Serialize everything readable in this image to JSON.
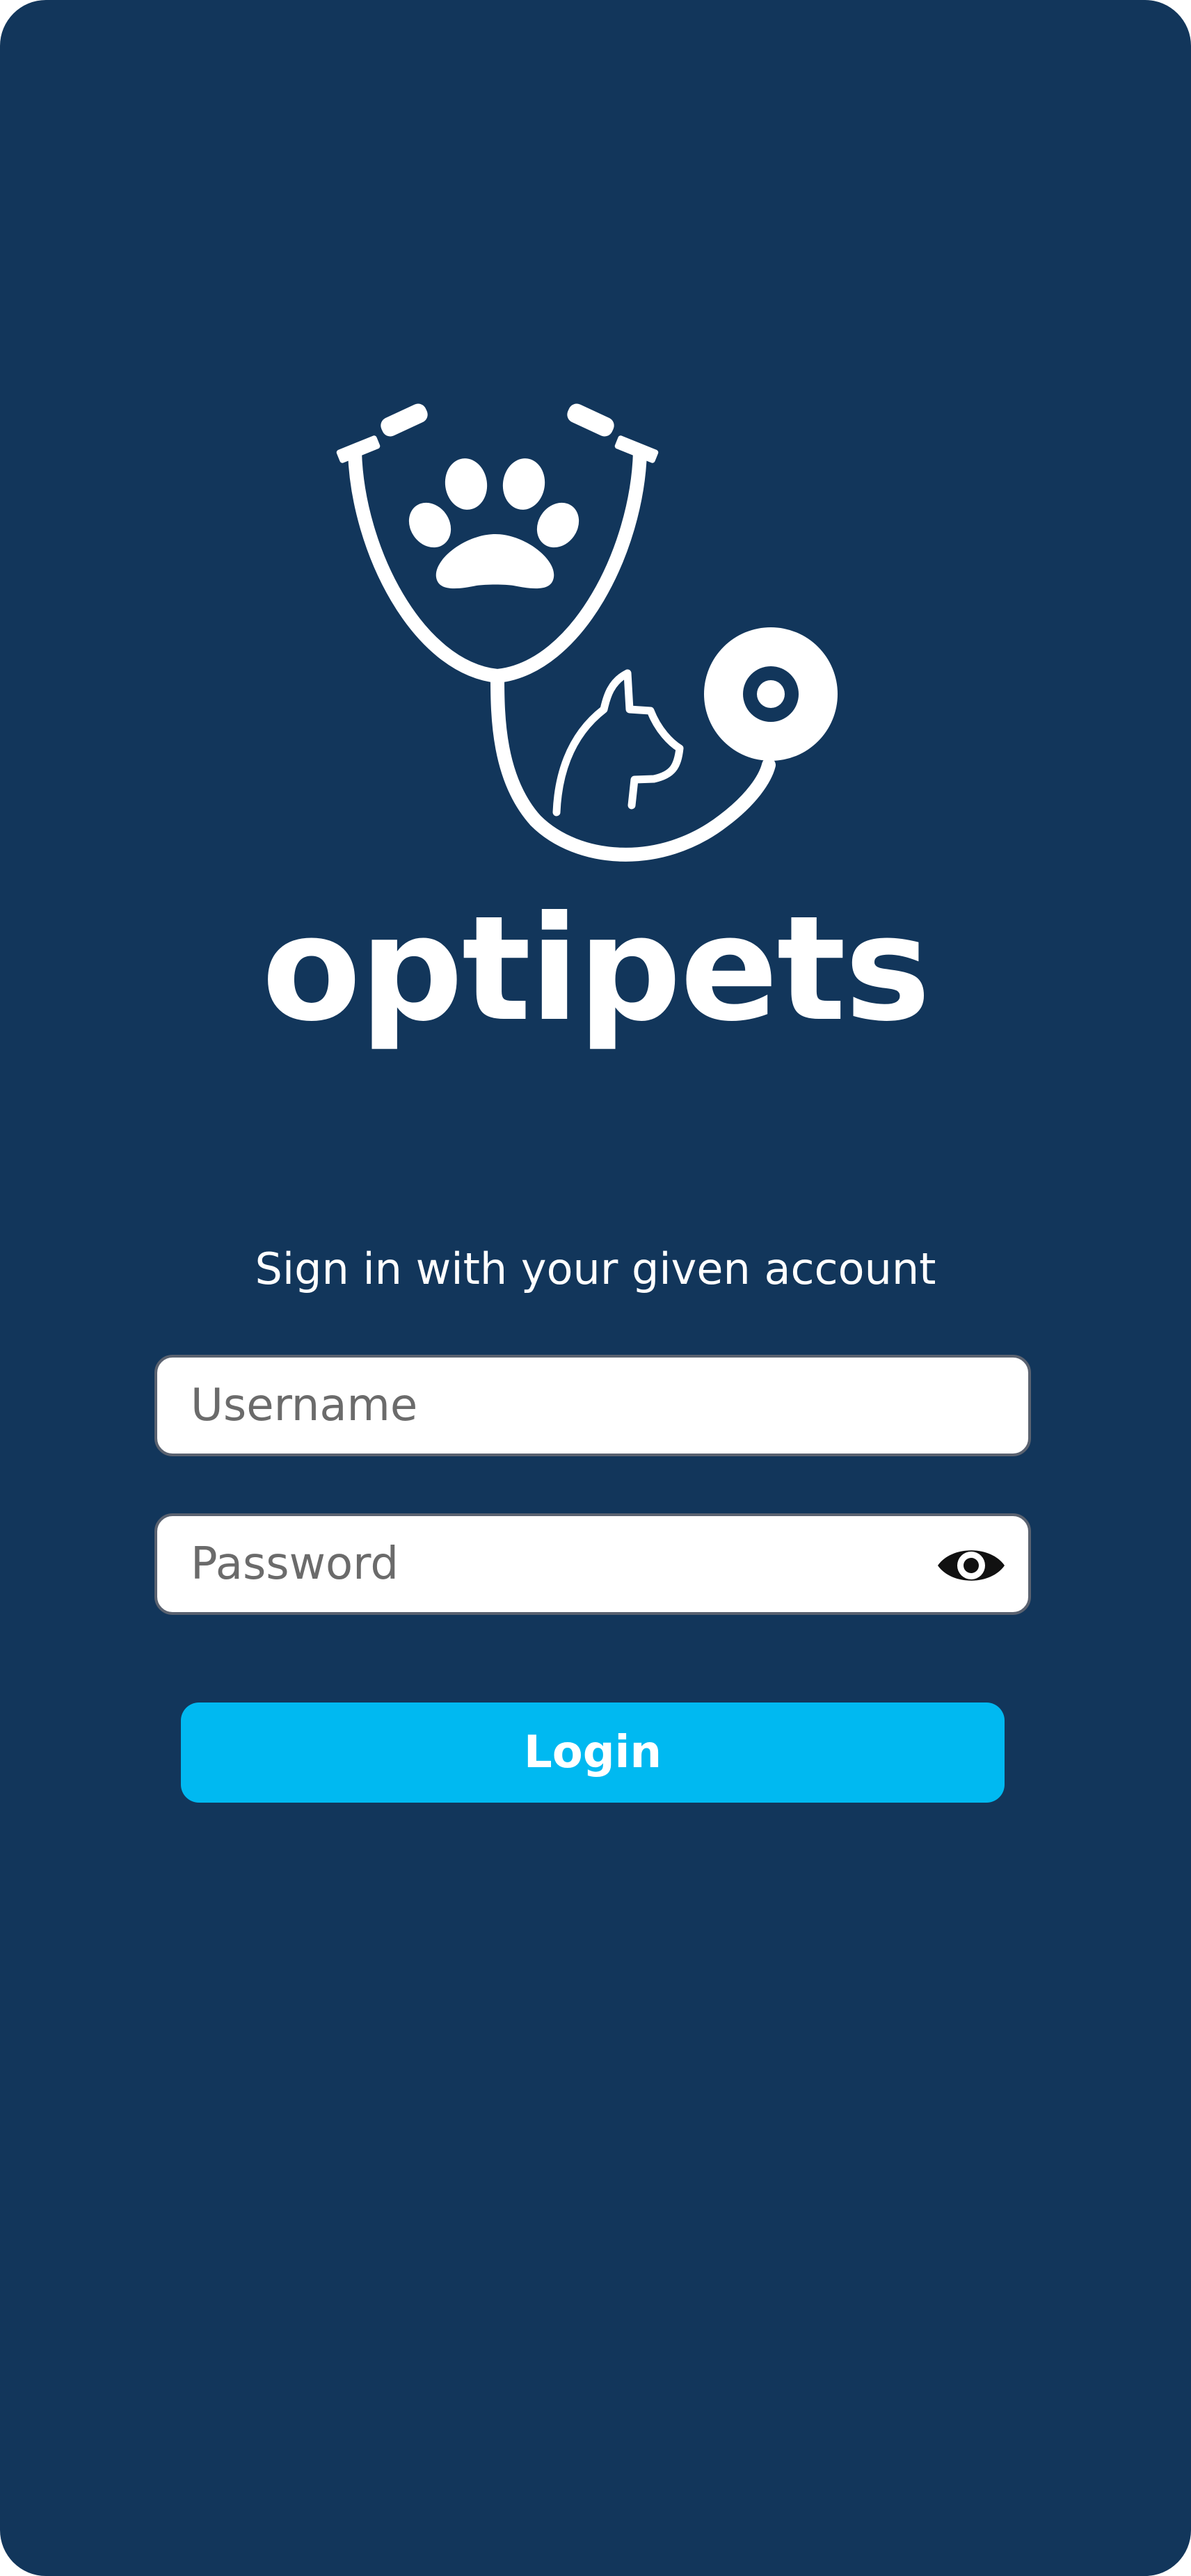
{
  "app": {
    "brand_name": "optipets"
  },
  "logo": {
    "icon_name": "stethoscope-paw-cat-logo",
    "color": "#ffffff"
  },
  "login_form": {
    "title": "Sign in with your given account",
    "username": {
      "value": "",
      "placeholder": "Username"
    },
    "password": {
      "value": "",
      "placeholder": "Password",
      "toggle_icon": "eye-icon"
    },
    "submit_label": "Login"
  },
  "colors": {
    "background": "#12365b",
    "accent": "#00b9f1",
    "field_background": "#ffffff",
    "text_light": "#ffffff"
  }
}
